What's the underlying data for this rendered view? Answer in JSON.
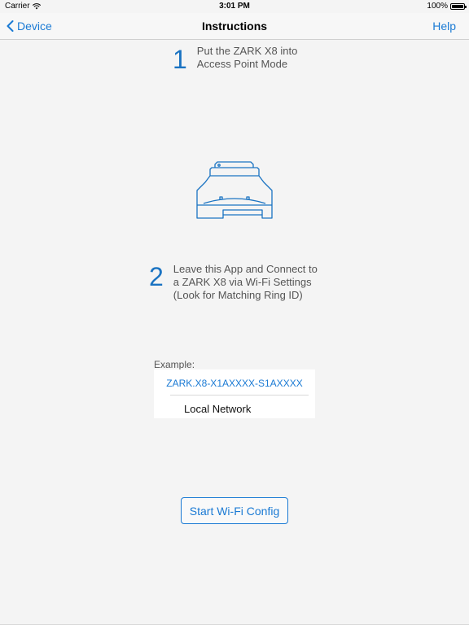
{
  "status_bar": {
    "carrier": "Carrier",
    "time": "3:01 PM",
    "battery": "100%",
    "icons": [
      "wifi-icon",
      "battery-icon"
    ]
  },
  "nav": {
    "back_label": "Device",
    "title": "Instructions",
    "help_label": "Help"
  },
  "steps": [
    {
      "number": "1",
      "lines": [
        "Put the ZARK X8 into",
        "Access Point Mode"
      ]
    },
    {
      "number": "2",
      "lines": [
        "Leave this App and Connect to",
        "a ZARK X8 via Wi-Fi Settings",
        "(Look for Matching Ring ID)"
      ]
    }
  ],
  "illustration": {
    "icon": "zark-x8-device-icon"
  },
  "example": {
    "label": "Example:",
    "network_name": "ZARK.X8-X1AXXXX-S1AXXXX",
    "local_network": "Local Network"
  },
  "start_button_label": "Start Wi-Fi Config",
  "colors": {
    "accent": "#1a7ad4",
    "background": "#f4f4f4",
    "card": "#ffffff"
  }
}
